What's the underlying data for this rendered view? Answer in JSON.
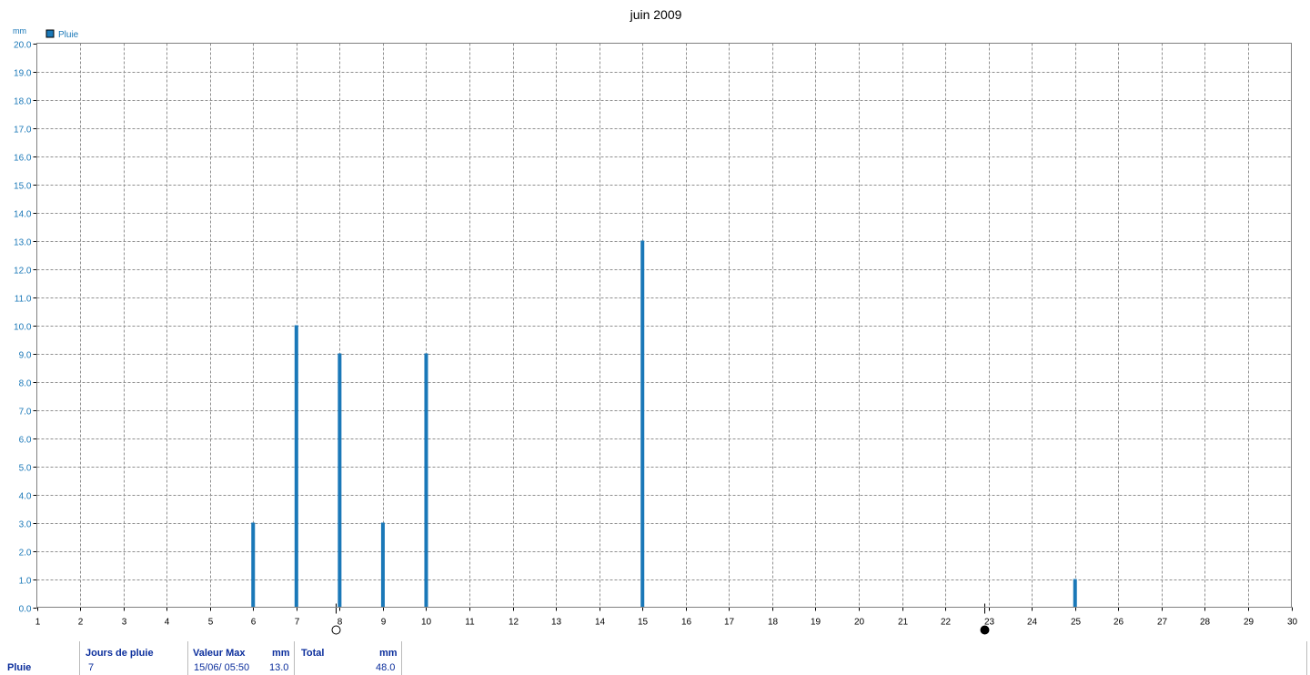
{
  "chart_data": {
    "type": "bar",
    "title": "juin 2009",
    "ylabel": "mm",
    "xlabel": "",
    "ylim": [
      0,
      20
    ],
    "xlim": [
      1,
      30
    ],
    "y_ticks": [
      "0.0",
      "1.0",
      "2.0",
      "3.0",
      "4.0",
      "5.0",
      "6.0",
      "7.0",
      "8.0",
      "9.0",
      "10.0",
      "11.0",
      "12.0",
      "13.0",
      "14.0",
      "15.0",
      "16.0",
      "17.0",
      "18.0",
      "19.0",
      "20.0"
    ],
    "x_ticks": [
      "1",
      "2",
      "3",
      "4",
      "5",
      "6",
      "7",
      "8",
      "9",
      "10",
      "11",
      "12",
      "13",
      "14",
      "15",
      "16",
      "17",
      "18",
      "19",
      "20",
      "21",
      "22",
      "23",
      "24",
      "25",
      "26",
      "27",
      "28",
      "29",
      "30"
    ],
    "grid": true,
    "legend_position": "top-left",
    "series": [
      {
        "name": "Pluie",
        "color": "#1a78b8",
        "x": [
          6,
          7,
          8,
          9,
          10,
          15,
          25
        ],
        "values": [
          3.0,
          10.0,
          9.0,
          3.0,
          9.0,
          13.0,
          1.0
        ]
      }
    ],
    "markers": [
      {
        "type": "moon-open",
        "x": 7.9
      },
      {
        "type": "moon-filled",
        "x": 22.9
      }
    ]
  },
  "stats": {
    "row_label": "Pluie",
    "jours_header": "Jours de pluie",
    "jours_value": "7",
    "valeurmax_header": "Valeur Max",
    "valeurmax_unit": "mm",
    "valeurmax_date": "15/06/  05:50",
    "valeurmax_value": "13.0",
    "total_header": "Total",
    "total_unit": "mm",
    "total_value": "48.0"
  }
}
